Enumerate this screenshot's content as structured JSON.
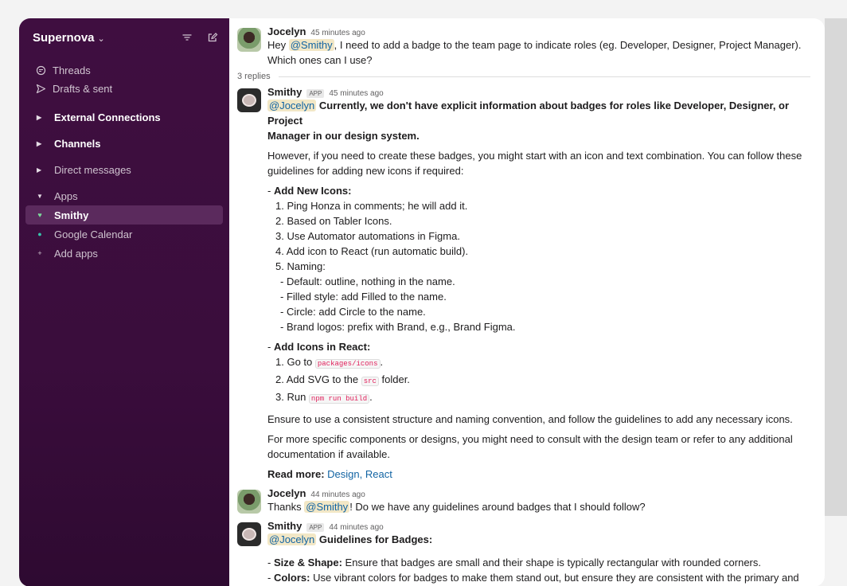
{
  "workspace": {
    "name": "Supernova",
    "chevron": "⌄"
  },
  "nav": [
    {
      "icon": "threads-icon",
      "label": "Threads"
    },
    {
      "icon": "send-icon",
      "label": "Drafts & sent"
    }
  ],
  "sections": {
    "external": "External Connections",
    "channels": "Channels",
    "direct": "Direct messages",
    "apps": "Apps"
  },
  "apps": [
    {
      "label": "Smithy",
      "active": true
    },
    {
      "label": "Google Calendar",
      "active": false
    }
  ],
  "add_apps": "Add apps",
  "messages": {
    "m1": {
      "author": "Jocelyn",
      "time": "45 minutes ago",
      "pre": "Hey ",
      "mention": "@Smithy",
      "post": ", I need to add a badge to the team page to indicate roles (eg. Developer, Designer, Project Manager).",
      "line2": "Which ones can I use?"
    },
    "replies_label": "3 replies",
    "m2": {
      "author": "Smithy",
      "tag": "APP",
      "time": "45 minutes ago",
      "mention": "@Jocelyn",
      "lead": "Currently, we don't have explicit information about badges for roles like Developer, Designer, or Project",
      "lead2": "Manager in our design system.",
      "p1a": "However, if you need to create these badges, you might start with an icon and text combination. You can follow these",
      "p1b": "guidelines for adding new icons if required:",
      "h1_dash": "- ",
      "h1": "Add New Icons:",
      "l1": "1. Ping Honza in comments; he will add it.",
      "l2": "2. Based on Tabler Icons.",
      "l3": "3. Use Automator automations in Figma.",
      "l4": "4. Add icon to React (run automatic build).",
      "l5": "5. Naming:",
      "n1": "- Default: outline, nothing in the name.",
      "n2": "- Filled style: add Filled to the name.",
      "n3": "- Circle: add Circle to the name.",
      "n4": "- Brand logos: prefix with Brand, e.g., Brand Figma.",
      "h2": "Add Icons in React:",
      "r1_pre": "1. Go to ",
      "r1_code": "packages/icons",
      "r1_post": ".",
      "r2_pre": "2. Add SVG to the ",
      "r2_code": "src",
      "r2_post": " folder.",
      "r3_pre": "3. Run ",
      "r3_code": "npm run build",
      "r3_post": ".",
      "p2": "Ensure to use a consistent structure and naming convention, and follow the guidelines to add any necessary icons.",
      "p3a": "For more specific components or designs, you might need to consult with the design team or refer to any additional",
      "p3b": "documentation if available.",
      "read_more": "Read more:",
      "links": "Design, React"
    },
    "m3": {
      "author": "Jocelyn",
      "time": "44 minutes ago",
      "pre": "Thanks ",
      "mention": "@Smithy",
      "post": "! Do we have any guidelines around badges that I should follow?"
    },
    "m4": {
      "author": "Smithy",
      "tag": "APP",
      "time": "44 minutes ago",
      "mention": "@Jocelyn",
      "lead": "Guidelines for Badges:",
      "s1_label": "Size & Shape:",
      "s1_text": " Ensure that badges are small and their shape is typically rectangular with rounded corners.",
      "s2_label": "Colors:",
      "s2_text": " Use vibrant colors for badges to make them stand out, but ensure they are consistent with the primary and"
    }
  }
}
